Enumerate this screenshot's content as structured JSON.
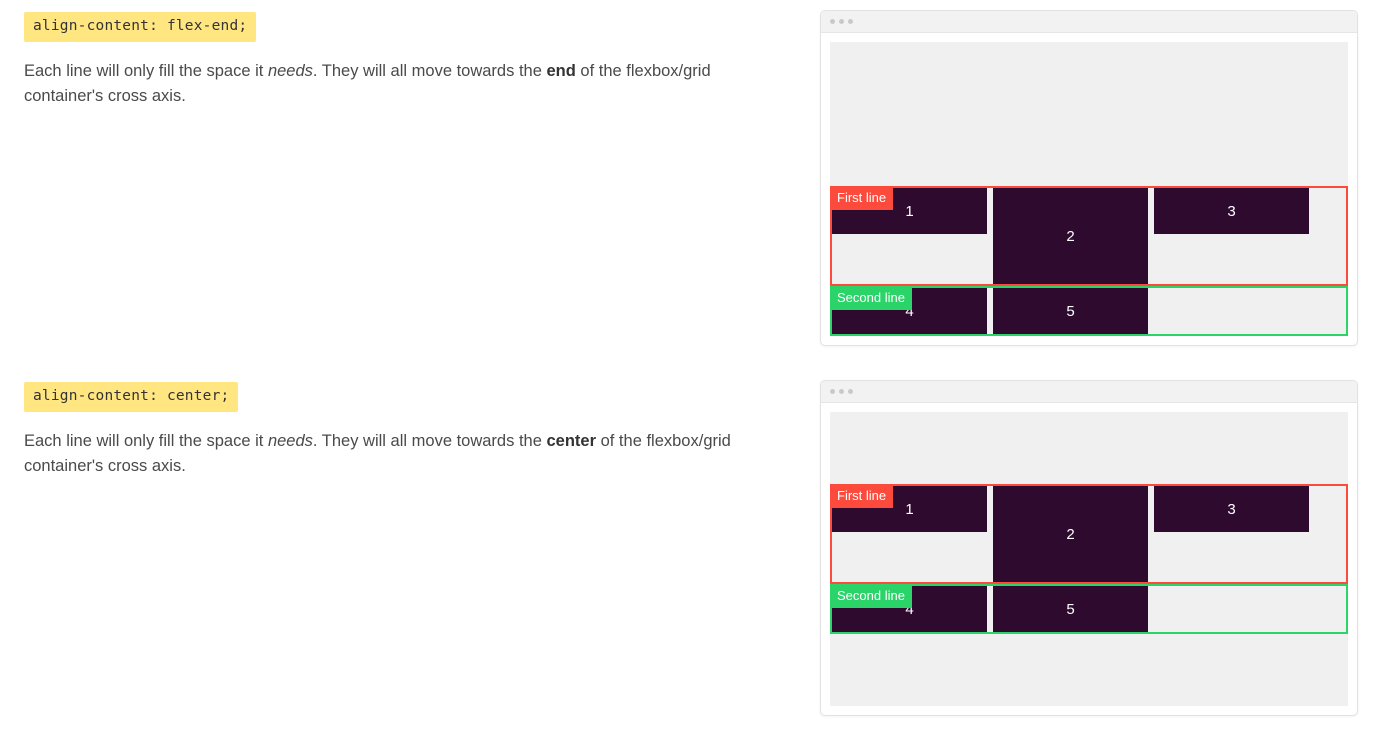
{
  "sections": [
    {
      "code": "align-content: flex-end;",
      "desc_parts": [
        "Each line will only fill the space it ",
        "needs",
        ". They will all move towards the ",
        "end",
        " of the flexbox/grid container's cross axis."
      ],
      "demo": {
        "align_content": "flex-end",
        "lines": [
          {
            "label": "First line",
            "label_color": "#fc4b3d",
            "items": [
              "1",
              "2",
              "3"
            ]
          },
          {
            "label": "Second line",
            "label_color": "#2bd469",
            "items": [
              "4",
              "5"
            ]
          }
        ]
      }
    },
    {
      "code": "align-content: center;",
      "desc_parts": [
        "Each line will only fill the space it ",
        "needs",
        ". They will all move towards the ",
        "center",
        " of the flexbox/grid container's cross axis."
      ],
      "demo": {
        "align_content": "center",
        "lines": [
          {
            "label": "First line",
            "label_color": "#fc4b3d",
            "items": [
              "1",
              "2",
              "3"
            ]
          },
          {
            "label": "Second line",
            "label_color": "#2bd469",
            "items": [
              "4",
              "5"
            ]
          }
        ]
      }
    }
  ],
  "chrome": {
    "dot_color": "#c9c9c9",
    "dots": [
      "dot-1",
      "dot-2",
      "dot-3"
    ]
  },
  "colors": {
    "code_highlight": "#ffe680",
    "item_bg": "#2d0a2e",
    "first_line_border": "#fc4b3d",
    "second_line_border": "#2bd469",
    "container_bg": "#f0f0f0",
    "text": "#4a4a4a"
  }
}
